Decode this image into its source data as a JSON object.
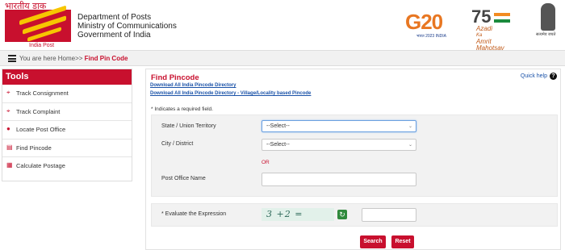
{
  "header": {
    "logo_hindi": "भारतीय डाक",
    "logo_caption": "India Post",
    "dept_line1": "Department of Posts",
    "dept_line2": "Ministry of Communications",
    "dept_line3": "Government of India",
    "g20_text": "G20",
    "g20_sub": "भारत 2023 INDIA",
    "azadi_number": "75",
    "azadi_line1": "Azadi",
    "azadi_line2": "Ka",
    "azadi_line3": "Amrit Mahotsav",
    "emblem_caption": "सत्यमेव जयते"
  },
  "breadcrumb": {
    "prefix": "You are here Home>> ",
    "current": "Find Pin Code"
  },
  "sidebar": {
    "title": "Tools",
    "items": [
      {
        "label": "Track Consignment",
        "icon": "crosshair-icon"
      },
      {
        "label": "Track Complaint",
        "icon": "crosshair-icon"
      },
      {
        "label": "Locate Post Office",
        "icon": "map-pin-icon"
      },
      {
        "label": "Find Pincode",
        "icon": "search-doc-icon"
      },
      {
        "label": "Calculate Postage",
        "icon": "calculator-icon"
      }
    ]
  },
  "main": {
    "title": "Find Pincode",
    "link_all_india": "Download All India Pincode Directory",
    "link_village": "Download All India Pincode Directory - Village/Locality based Pincode",
    "quick_help": "Quick help",
    "required_note": "* Indicates a required field.",
    "state_label": "State / Union Territory",
    "state_value": "--Select--",
    "city_label": "City / District",
    "city_value": "--Select--",
    "or_text": "OR",
    "po_label": "Post Office Name",
    "po_value": "",
    "captcha_label": "* Evaluate the Expression",
    "captcha_text": "3 +2 =",
    "captcha_answer": "",
    "search_label": "Search",
    "reset_label": "Reset"
  },
  "colors": {
    "brand_red": "#c8102e",
    "link_blue": "#1a52a8",
    "panel_gray": "#f2f2f2"
  }
}
